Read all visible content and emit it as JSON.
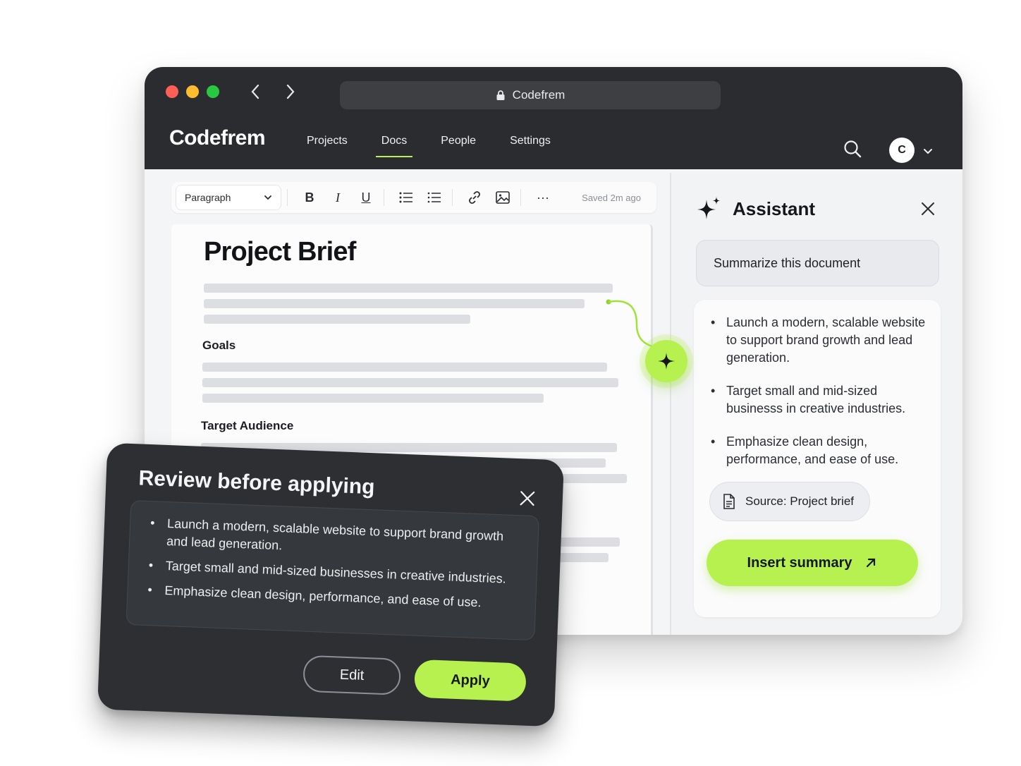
{
  "browser": {
    "url_text": "Codefrem",
    "window_dots": [
      "#ff5f57",
      "#febc2e",
      "#28c840"
    ]
  },
  "app": {
    "brand": "Codefrem",
    "nav": [
      {
        "label": "Projects",
        "active": false
      },
      {
        "label": "Docs",
        "active": true
      },
      {
        "label": "People",
        "active": false
      },
      {
        "label": "Settings",
        "active": false
      }
    ],
    "avatar_initial": "C",
    "accent": "#b6f14f"
  },
  "editor": {
    "block_type": "Paragraph",
    "saved_status": "Saved 2m ago",
    "toolbar_icons": [
      "bold-icon",
      "italic-icon",
      "underline-icon",
      "bullet-list-icon",
      "numbered-list-icon",
      "link-icon",
      "image-icon",
      "more-icon"
    ],
    "title": "Project Brief",
    "headings": [
      "Goals",
      "Target Audience"
    ]
  },
  "assistant": {
    "title": "Assistant",
    "prompt": "Summarize this document",
    "summary": [
      "Launch a modern, scalable website to support brand growth and lead generation.",
      "Target small and mid-sized businesss in creative industries.",
      "Emphasize clean design, performance, and ease of use."
    ],
    "source": "Source: Project brief",
    "insert_label": "Insert summary"
  },
  "review": {
    "title": "Review before applying",
    "items": [
      "Launch a modern, scalable website to support brand growth and lead generation.",
      "Target small and mid-sized businesses in creative industries.",
      "Emphasize clean design, performance, and ease of use."
    ],
    "edit_label": "Edit",
    "apply_label": "Apply"
  }
}
